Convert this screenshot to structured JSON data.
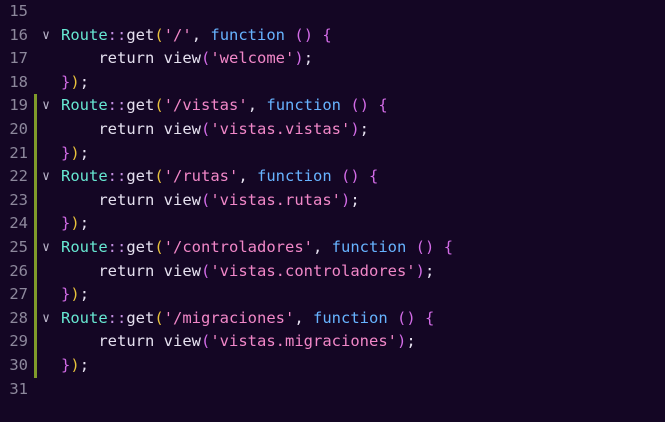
{
  "lines": [
    {
      "num": "15"
    },
    {
      "num": "16",
      "fold": "∨",
      "tokens": [
        [
          "cls",
          "Route"
        ],
        [
          "op",
          "::"
        ],
        [
          "fn",
          "get"
        ],
        [
          "p1",
          "("
        ],
        [
          "str",
          "'/'"
        ],
        [
          "pl",
          ", "
        ],
        [
          "kw",
          "function"
        ],
        [
          "pl",
          " "
        ],
        [
          "p2",
          "()"
        ],
        [
          "pl",
          " "
        ],
        [
          "p2",
          "{"
        ]
      ]
    },
    {
      "num": "17",
      "tokens": [
        [
          "pl",
          "    "
        ],
        [
          "ret",
          "return"
        ],
        [
          "pl",
          " "
        ],
        [
          "fn",
          "view"
        ],
        [
          "p2",
          "("
        ],
        [
          "str",
          "'welcome'"
        ],
        [
          "p2",
          ")"
        ],
        [
          "pl",
          ";"
        ]
      ]
    },
    {
      "num": "18",
      "tokens": [
        [
          "p2",
          "}"
        ],
        [
          "p1",
          ")"
        ],
        [
          "pl",
          ";"
        ]
      ]
    },
    {
      "num": "19",
      "fold": "∨",
      "tokens": [
        [
          "cls",
          "Route"
        ],
        [
          "op",
          "::"
        ],
        [
          "fn",
          "get"
        ],
        [
          "p1",
          "("
        ],
        [
          "str",
          "'/vistas'"
        ],
        [
          "pl",
          ", "
        ],
        [
          "kw",
          "function"
        ],
        [
          "pl",
          " "
        ],
        [
          "p2",
          "()"
        ],
        [
          "pl",
          " "
        ],
        [
          "p2",
          "{"
        ]
      ]
    },
    {
      "num": "20",
      "tokens": [
        [
          "pl",
          "    "
        ],
        [
          "ret",
          "return"
        ],
        [
          "pl",
          " "
        ],
        [
          "fn",
          "view"
        ],
        [
          "p2",
          "("
        ],
        [
          "str",
          "'vistas.vistas'"
        ],
        [
          "p2",
          ")"
        ],
        [
          "pl",
          ";"
        ]
      ]
    },
    {
      "num": "21",
      "tokens": [
        [
          "p2",
          "}"
        ],
        [
          "p1",
          ")"
        ],
        [
          "pl",
          ";"
        ]
      ]
    },
    {
      "num": "22",
      "fold": "∨",
      "tokens": [
        [
          "cls",
          "Route"
        ],
        [
          "op",
          "::"
        ],
        [
          "fn",
          "get"
        ],
        [
          "p1",
          "("
        ],
        [
          "str",
          "'/rutas'"
        ],
        [
          "pl",
          ", "
        ],
        [
          "kw",
          "function"
        ],
        [
          "pl",
          " "
        ],
        [
          "p2",
          "()"
        ],
        [
          "pl",
          " "
        ],
        [
          "p2",
          "{"
        ]
      ]
    },
    {
      "num": "23",
      "tokens": [
        [
          "pl",
          "    "
        ],
        [
          "ret",
          "return"
        ],
        [
          "pl",
          " "
        ],
        [
          "fn",
          "view"
        ],
        [
          "p2",
          "("
        ],
        [
          "str",
          "'vistas.rutas'"
        ],
        [
          "p2",
          ")"
        ],
        [
          "pl",
          ";"
        ]
      ]
    },
    {
      "num": "24",
      "tokens": [
        [
          "p2",
          "}"
        ],
        [
          "p1",
          ")"
        ],
        [
          "pl",
          ";"
        ]
      ]
    },
    {
      "num": "25",
      "fold": "∨",
      "tokens": [
        [
          "cls",
          "Route"
        ],
        [
          "op",
          "::"
        ],
        [
          "fn",
          "get"
        ],
        [
          "p1",
          "("
        ],
        [
          "str",
          "'/controladores'"
        ],
        [
          "pl",
          ", "
        ],
        [
          "kw",
          "function"
        ],
        [
          "pl",
          " "
        ],
        [
          "p2",
          "()"
        ],
        [
          "pl",
          " "
        ],
        [
          "p2",
          "{"
        ]
      ]
    },
    {
      "num": "26",
      "tokens": [
        [
          "pl",
          "    "
        ],
        [
          "ret",
          "return"
        ],
        [
          "pl",
          " "
        ],
        [
          "fn",
          "view"
        ],
        [
          "p2",
          "("
        ],
        [
          "str",
          "'vistas.controladores'"
        ],
        [
          "p2",
          ")"
        ],
        [
          "pl",
          ";"
        ]
      ]
    },
    {
      "num": "27",
      "tokens": [
        [
          "p2",
          "}"
        ],
        [
          "p1",
          ")"
        ],
        [
          "pl",
          ";"
        ]
      ]
    },
    {
      "num": "28",
      "fold": "∨",
      "tokens": [
        [
          "cls",
          "Route"
        ],
        [
          "op",
          "::"
        ],
        [
          "fn",
          "get"
        ],
        [
          "p1",
          "("
        ],
        [
          "str",
          "'/migraciones'"
        ],
        [
          "pl",
          ", "
        ],
        [
          "kw",
          "function"
        ],
        [
          "pl",
          " "
        ],
        [
          "p2",
          "()"
        ],
        [
          "pl",
          " "
        ],
        [
          "p2",
          "{"
        ]
      ]
    },
    {
      "num": "29",
      "tokens": [
        [
          "pl",
          "    "
        ],
        [
          "ret",
          "return"
        ],
        [
          "pl",
          " "
        ],
        [
          "fn",
          "view"
        ],
        [
          "p2",
          "("
        ],
        [
          "str",
          "'vistas.migraciones'"
        ],
        [
          "p2",
          ")"
        ],
        [
          "pl",
          ";"
        ]
      ]
    },
    {
      "num": "30",
      "tokens": [
        [
          "p2",
          "}"
        ],
        [
          "p1",
          ")"
        ],
        [
          "pl",
          ";"
        ]
      ]
    },
    {
      "num": "31"
    }
  ],
  "modified_lines": [
    "19",
    "20",
    "21",
    "22",
    "23",
    "24",
    "25",
    "26",
    "27",
    "28",
    "29",
    "30"
  ],
  "colors": {
    "background": "#140624",
    "class": "#67e8d2",
    "string": "#f187c8",
    "keyword": "#67b3ff",
    "paren_outer": "#e8c23b",
    "paren_inner": "#d26be6",
    "modified_bar": "#7f9a2a"
  }
}
